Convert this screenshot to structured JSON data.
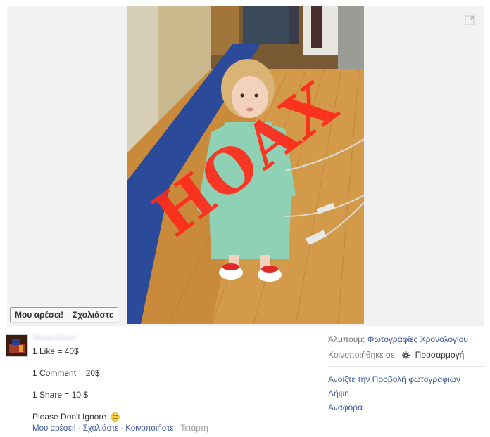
{
  "photo": {
    "stamp_text": "HOAX",
    "like_button": "Μου αρέσει!",
    "comment_button": "Σχολιάστε"
  },
  "post": {
    "author_name": "Mariya Bence",
    "lines": [
      "1 Like = 40$",
      "1 Comment = 20$",
      "1 Share = 10 $"
    ],
    "plea": "Please Don't Ignore",
    "actions": {
      "like": "Μου αρέσει!",
      "comment": "Σχολιάστε",
      "share": "Κοινοποιήστε",
      "separator": "·",
      "time": "Τετάρτη"
    }
  },
  "sidebar": {
    "album_label": "Άλμπουμ:",
    "album_value": "Φωτογραφίες Χρονολογίου",
    "shared_label": "Κοινοποιήθηκε σε:",
    "shared_value": "Προσαρμογή",
    "links": [
      "Ανοίξτε την Προβολή φωτογραφιών",
      "Λήψη",
      "Αναφορά"
    ]
  },
  "colors": {
    "link": "#3b5998",
    "stamp": "#ff2a1a",
    "floor": "#c98a3c"
  },
  "icons": [
    "expand-icon",
    "gear-icon",
    "smiley-icon"
  ]
}
